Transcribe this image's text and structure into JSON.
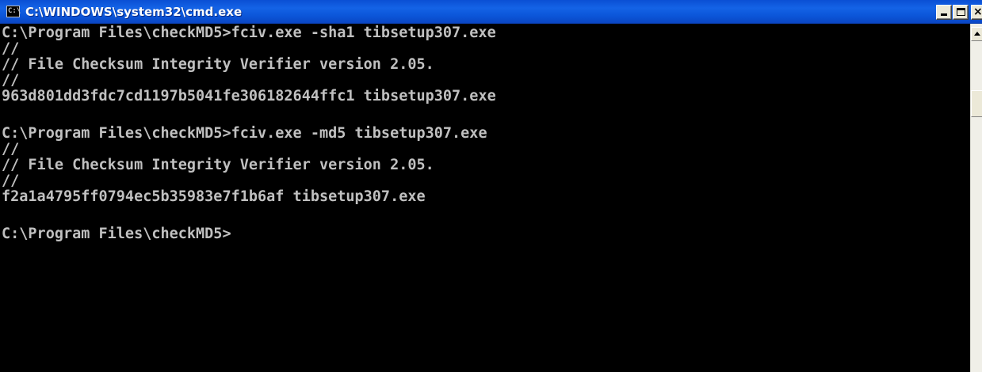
{
  "window": {
    "title": "C:\\WINDOWS\\system32\\cmd.exe",
    "icon": "cmd-console-icon",
    "icon_glyph": "C:\\"
  },
  "console": {
    "lines": [
      "C:\\Program Files\\checkMD5>fciv.exe -sha1 tibsetup307.exe",
      "//",
      "// File Checksum Integrity Verifier version 2.05.",
      "//",
      "963d801dd3fdc7cd1197b5041fe306182644ffc1 tibsetup307.exe",
      "",
      "C:\\Program Files\\checkMD5>fciv.exe -md5 tibsetup307.exe",
      "//",
      "// File Checksum Integrity Verifier version 2.05.",
      "//",
      "f2a1a4795ff0794ec5b35983e7f1b6af tibsetup307.exe",
      "",
      "C:\\Program Files\\checkMD5>"
    ]
  },
  "colors": {
    "titlebar": "#0a4fd4",
    "console_bg": "#000000",
    "console_fg": "#c0c0c0"
  }
}
